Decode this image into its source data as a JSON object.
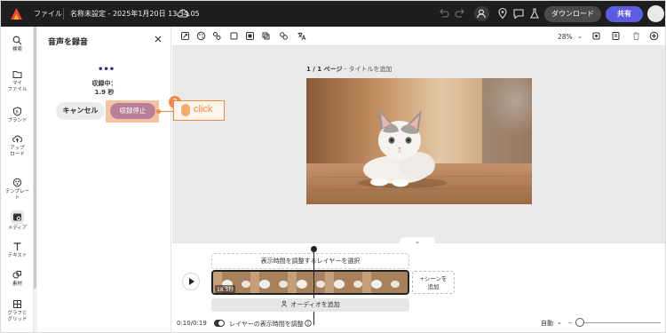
{
  "topbar": {
    "files_label": "ファイル",
    "doc_title": "名称未設定 - 2025年1月20日 13.34.05",
    "download_label": "ダウンロード",
    "share_label": "共有"
  },
  "rail": {
    "items": [
      {
        "label": "検索",
        "icon": "search-icon"
      },
      {
        "label": "マイ\nファイル",
        "icon": "folder-icon"
      },
      {
        "label": "ブランド",
        "icon": "brand-icon"
      },
      {
        "label": "アップ\nロード",
        "icon": "upload-icon"
      },
      {
        "label": "テンプレー\nト",
        "icon": "template-icon"
      },
      {
        "label": "メディア",
        "icon": "media-icon"
      },
      {
        "label": "テキスト",
        "icon": "text-icon"
      },
      {
        "label": "素材",
        "icon": "elements-icon"
      },
      {
        "label": "グラフと\nグリッド",
        "icon": "grid-icon"
      }
    ]
  },
  "panel": {
    "title": "音声を録音",
    "recording_status": "収録中：",
    "recording_time": "1.9 秒",
    "cancel_label": "キャンセル",
    "stop_label": "収録停止"
  },
  "annotation": {
    "step_number": "3",
    "click_text": "click",
    "accent_color": "#f08a3c"
  },
  "editor": {
    "zoom": "28%",
    "page_number": "1 / 1 ページ",
    "page_title_placeholder": " - タイトルを追加"
  },
  "timeline": {
    "hint": "表示時間を調整するレイヤーを選択",
    "scene_duration": "18.5秒",
    "add_scene": "+シーンを\n追加",
    "add_audio": "オーディオを追加",
    "time": "0:10/0:19",
    "toggle_label": "レイヤーの表示時間を調整",
    "auto_label": "自動"
  },
  "colors": {
    "topbar_bg": "#1e1e1e",
    "share_button": "#5c5ce0",
    "stop_button": "#b6809a",
    "highlight": "#f5b98e"
  }
}
